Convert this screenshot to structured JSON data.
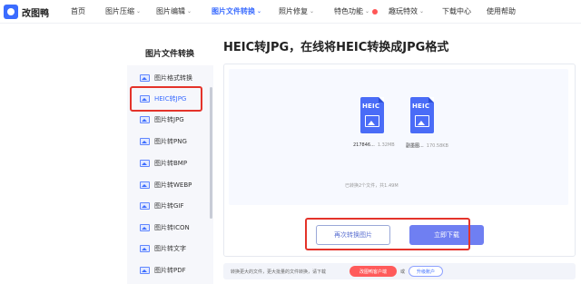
{
  "header": {
    "logo_text": "改图鸭",
    "nav": [
      {
        "label": "首页"
      },
      {
        "label": "图片压缩"
      },
      {
        "label": "图片编辑"
      },
      {
        "label": "图片文件转换"
      },
      {
        "label": "照片修复"
      },
      {
        "label": "特色功能"
      },
      {
        "label": "趣玩特效"
      },
      {
        "label": "下载中心"
      },
      {
        "label": "使用帮助"
      }
    ]
  },
  "sidebar": {
    "title": "图片文件转换",
    "items": [
      {
        "label": "图片格式转换"
      },
      {
        "label": "HEIC转JPG"
      },
      {
        "label": "图片转JPG"
      },
      {
        "label": "图片转PNG"
      },
      {
        "label": "图片转BMP"
      },
      {
        "label": "图片转WEBP"
      },
      {
        "label": "图片转GIF"
      },
      {
        "label": "图片转ICON"
      },
      {
        "label": "图片转文字"
      },
      {
        "label": "图片转PDF"
      }
    ]
  },
  "main": {
    "title": "HEIC转JPG，在线将HEIC转换成JPG格式",
    "files": [
      {
        "ext": "HEIC",
        "name": "217846...",
        "size": "1.32MB"
      },
      {
        "ext": "HEIC",
        "name": "副墨图...",
        "size": "170.58KB"
      }
    ],
    "summary": "已转换2个文件，共1.49M",
    "convert_again_label": "再次转换图片",
    "download_label": "立即下载"
  },
  "notice": {
    "text": "转换更大的文件，更大批量的文件转换，请下载",
    "client_button": "改图鸭客户端",
    "or_text": "或",
    "upgrade_button": "升级账户"
  },
  "colors": {
    "accent": "#3b6cff",
    "highlight_border": "#e4332a"
  }
}
